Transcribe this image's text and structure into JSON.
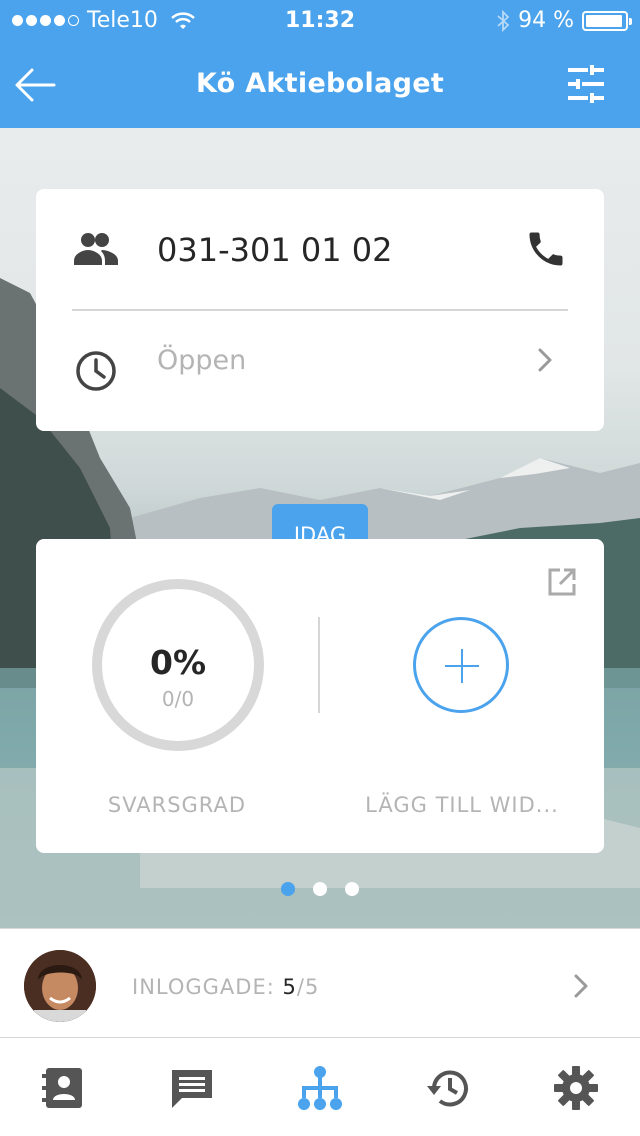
{
  "status_bar": {
    "carrier": "Tele10",
    "time": "11:32",
    "battery": "94 %",
    "battery_level": 0.94,
    "signal_bars": 4
  },
  "nav": {
    "title": "Kö Aktiebolaget",
    "back_icon": "arrow-left-icon",
    "filter_icon": "sliders-icon"
  },
  "queue_card": {
    "phone": "031-301 01 02",
    "hours": "Öppen",
    "group_icon": "people-icon",
    "call_icon": "phone-icon",
    "clock_icon": "clock-icon"
  },
  "stats": {
    "tab_label": "IDAG",
    "percent": "0%",
    "ratio": "0/0",
    "answer_rate_label": "SVARSGRAD",
    "add_widget_label": "LÄGG TILL WID...",
    "open_external_icon": "open-external-icon",
    "add_icon": "plus-icon"
  },
  "pager": {
    "pages": 3,
    "active": 0
  },
  "logged_in": {
    "label": "INLOGGADE:",
    "current": "5",
    "total": "/5"
  },
  "tabbar": {
    "items": [
      {
        "icon": "contacts-icon",
        "active": false
      },
      {
        "icon": "chat-icon",
        "active": false
      },
      {
        "icon": "org-chart-icon",
        "active": true
      },
      {
        "icon": "history-icon",
        "active": false
      },
      {
        "icon": "gear-icon",
        "active": false
      }
    ]
  },
  "colors": {
    "accent": "#4aa3ec",
    "text_dark": "#262626",
    "text_muted": "#b4b4b4",
    "icon_gray": "#555555"
  }
}
